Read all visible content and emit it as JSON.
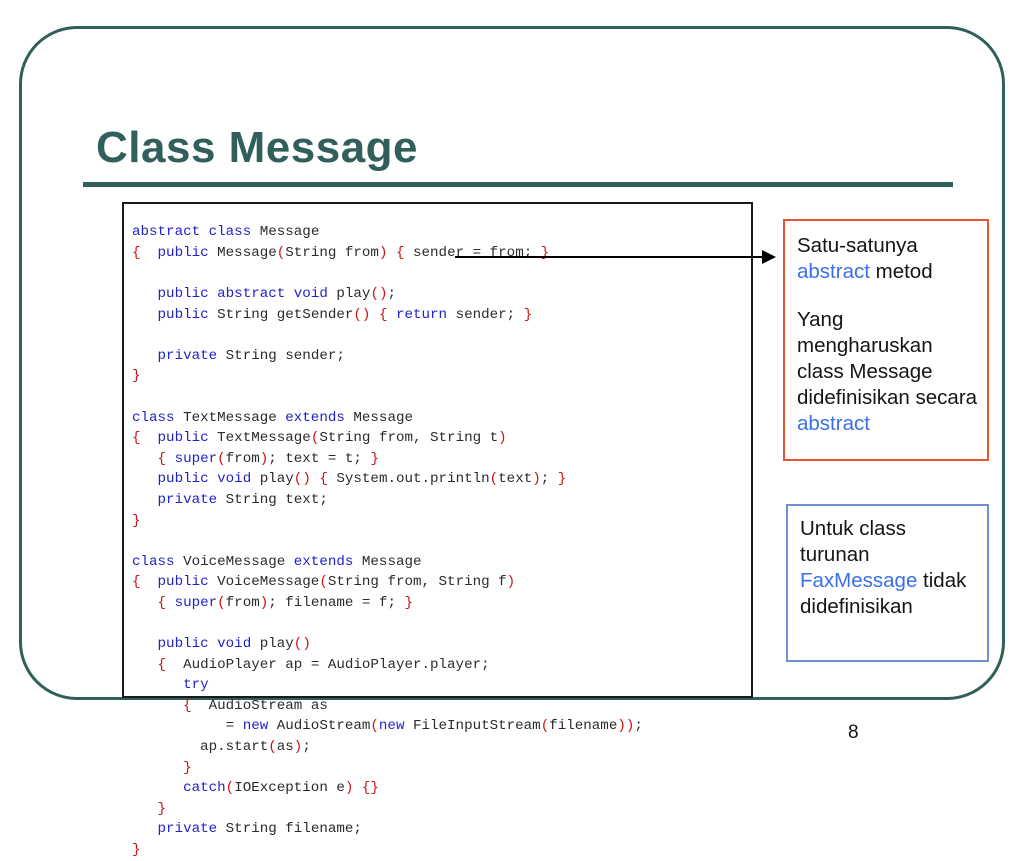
{
  "slide": {
    "title": "Class Message",
    "page_number": "8",
    "frame_color": "#31605c",
    "title_color": "#31605c"
  },
  "code_block": {
    "language": "java",
    "colors": {
      "keyword": "#2222cc",
      "punctuation": "#cc1111",
      "identifier": "#2b2b2b",
      "border": "#1a1a1a"
    },
    "lines": [
      "abstract class Message",
      "{  public Message(String from) { sender = from; }",
      "",
      "   public abstract void play();",
      "   public String getSender() { return sender; }",
      "",
      "   private String sender;",
      "}",
      "",
      "class TextMessage extends Message",
      "{  public TextMessage(String from, String t)",
      "   { super(from); text = t; }",
      "   public void play() { System.out.println(text); }",
      "   private String text;",
      "}",
      "",
      "class VoiceMessage extends Message",
      "{  public VoiceMessage(String from, String f)",
      "   { super(from); filename = f; }",
      "",
      "   public void play()",
      "   {  AudioPlayer ap = AudioPlayer.player;",
      "      try",
      "      {  AudioStream as",
      "           = new AudioStream(new FileInputStream(filename));",
      "        ap.start(as);",
      "      }",
      "      catch(IOException e) {}",
      "   }",
      "   private String filename;",
      "}"
    ]
  },
  "callouts": {
    "abstract_note": {
      "border_color": "#e8542e",
      "highlight_color": "#3b6fe8",
      "paragraph_1": {
        "before": "Satu-satunya ",
        "highlight": "abstract",
        "after": " metod"
      },
      "paragraph_2": {
        "before": "Yang mengharuskan class Message didefinisikan secara ",
        "highlight": "abstract",
        "after": ""
      }
    },
    "fax_note": {
      "border_color": "#6f8fd6",
      "highlight_color": "#3b6fe8",
      "paragraph_1": {
        "before": "Untuk class turunan ",
        "highlight": "FaxMessage",
        "after": " tidak didefinisikan"
      }
    }
  },
  "arrow": {
    "name": "pointer-arrow",
    "from": "abstract method declaration",
    "to": "abstract_note callout"
  }
}
